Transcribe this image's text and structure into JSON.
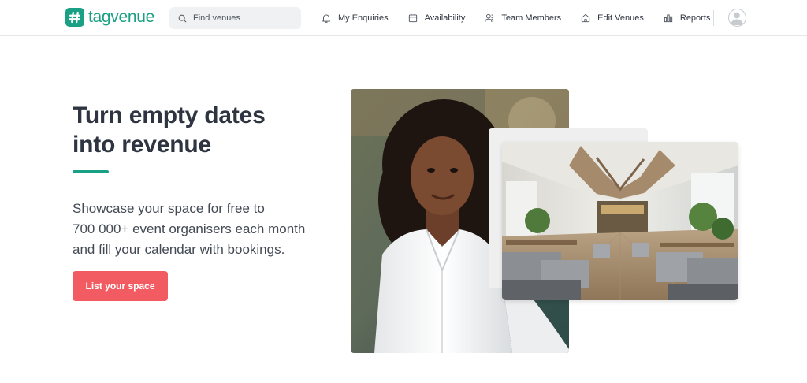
{
  "app": {
    "brand": "tagvenue",
    "brand_color": "#1aa084",
    "accent_color": "#f35b62"
  },
  "search": {
    "placeholder": "Find venues",
    "icon": "search-icon"
  },
  "nav": {
    "items": [
      {
        "label": "My Enquiries",
        "icon": "bell-icon"
      },
      {
        "label": "Availability",
        "icon": "calendar-icon"
      },
      {
        "label": "Team Members",
        "icon": "users-icon"
      },
      {
        "label": "Edit Venues",
        "icon": "home-icon"
      },
      {
        "label": "Reports",
        "icon": "bar-chart-icon"
      }
    ],
    "avatar_icon": "user-avatar-icon"
  },
  "hero": {
    "title_line1": "Turn empty dates",
    "title_line2": "into revenue",
    "subtitle_line1": "Showcase your space for free to",
    "subtitle_line2": "700 000+ event organisers each month",
    "subtitle_line3": "and fill your calendar with bookings.",
    "cta_label": "List your space"
  },
  "images": {
    "woman_photo": "photo of smiling woman in white shirt",
    "venue_photo": "photo of restaurant venue interior"
  }
}
